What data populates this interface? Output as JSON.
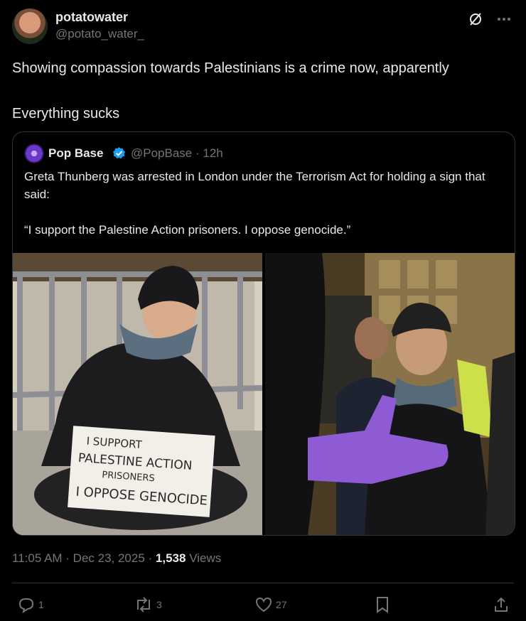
{
  "author": {
    "name": "potatowater",
    "handle": "@potato_water_"
  },
  "post": {
    "text": "Showing compassion towards Palestinians is a crime now, apparently\n\nEverything sucks"
  },
  "quote": {
    "name": "Pop Base",
    "handle_time": "@PopBase · 12h",
    "text": "Greta Thunberg was arrested in London under the Terrorism Act for holding a sign that said:\n\n“I support the Palestine Action prisoners. I oppose genocide.”",
    "sign_lines": [
      "I SUPPORT",
      "PALESTINE ACTION",
      "PRISONERS",
      "I OPPOSE GENOCIDE"
    ]
  },
  "meta": {
    "time_date": "11:05 AM · Dec 23, 2025 · ",
    "views_count": "1,538",
    "views_label": " Views"
  },
  "actions": {
    "replies": "1",
    "reposts": "3",
    "likes": "27"
  },
  "colors": {
    "background": "#000000",
    "text": "#e7e9ea",
    "muted": "#71767b",
    "border": "#2f3336",
    "verified": "#1d9bf0"
  },
  "icons": [
    "grok-icon",
    "more-icon",
    "reply-icon",
    "repost-icon",
    "like-icon",
    "bookmark-icon",
    "share-icon",
    "verified-icon"
  ]
}
